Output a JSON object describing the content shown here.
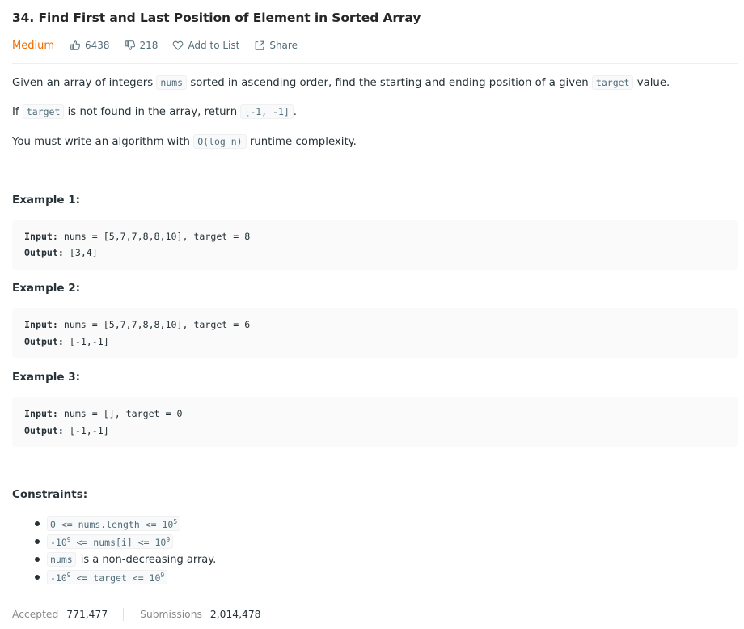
{
  "problem": {
    "title": "34. Find First and Last Position of Element in Sorted Array",
    "difficulty": "Medium",
    "likes": "6438",
    "dislikes": "218",
    "add_to_list": "Add to List",
    "share": "Share"
  },
  "description": {
    "p1": {
      "pre": "Given an array of integers ",
      "code1": "nums",
      "mid": " sorted in ascending order, find the starting and ending position of a given ",
      "code2": "target",
      "post": " value."
    },
    "p2": {
      "pre": "If ",
      "code1": "target",
      "mid": " is not found in the array, return ",
      "code2": "[-1, -1]",
      "post": "."
    },
    "p3": {
      "pre": "You must write an algorithm with ",
      "code1": "O(log n)",
      "post": " runtime complexity."
    }
  },
  "examples": [
    {
      "heading": "Example 1:",
      "input_label": "Input:",
      "input": " nums = [5,7,7,8,8,10], target = 8",
      "output_label": "Output:",
      "output": " [3,4]"
    },
    {
      "heading": "Example 2:",
      "input_label": "Input:",
      "input": " nums = [5,7,7,8,8,10], target = 6",
      "output_label": "Output:",
      "output": " [-1,-1]"
    },
    {
      "heading": "Example 3:",
      "input_label": "Input:",
      "input": " nums = [], target = 0",
      "output_label": "Output:",
      "output": " [-1,-1]"
    }
  ],
  "constraints": {
    "heading": "Constraints:",
    "c1": {
      "base": "0 <= nums.length <= 10",
      "exp": "5"
    },
    "c2": {
      "a": "-10",
      "a_exp": "9",
      "b": " <= nums[i] <= 10",
      "b_exp": "9"
    },
    "c3": {
      "code": "nums",
      "text": "is a non-decreasing array."
    },
    "c4": {
      "a": "-10",
      "a_exp": "9",
      "b": " <= target <= 10",
      "b_exp": "9"
    }
  },
  "stats": {
    "accepted_label": "Accepted",
    "accepted_value": "771,477",
    "submissions_label": "Submissions",
    "submissions_value": "2,014,478"
  },
  "colors": {
    "difficulty_medium": "#ef6c00",
    "meta_text": "#546e7a",
    "code_bg": "#fafafa"
  },
  "icons": [
    "thumbs-up-icon",
    "thumbs-down-icon",
    "heart-icon",
    "share-icon"
  ]
}
